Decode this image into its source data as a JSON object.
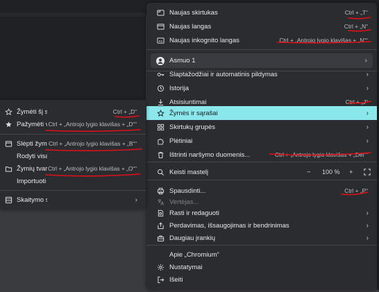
{
  "main_menu": {
    "new_tab": {
      "label": "Naujas skirtukas",
      "shortcut": "Ctrl + „T“"
    },
    "new_window": {
      "label": "Naujas langas",
      "shortcut": "Ctrl + „N“"
    },
    "incognito": {
      "label": "Naujas inkognito langas",
      "shortcut": "Ctrl + „Antrojo lygio klavišas + „N““"
    },
    "profile": {
      "label": "Asmuo 1"
    },
    "passwords": {
      "label": "Slaptažodžiai ir automatinis pildymas"
    },
    "history": {
      "label": "Istorija"
    },
    "downloads": {
      "label": "Atsisiuntimai",
      "shortcut": "Ctrl + „J“"
    },
    "bookmarks": {
      "label": "Žymės ir sąrašai"
    },
    "tab_groups": {
      "label": "Skirtukų grupės"
    },
    "extensions": {
      "label": "Plėtiniai"
    },
    "clear_data": {
      "label": "Ištrinti naršymo duomenis...",
      "shortcut": "Ctrl + „Antrojo lygio klavišas + „Del““"
    },
    "zoom": {
      "label": "Keisti mastelį",
      "minus": "−",
      "value": "100 %",
      "plus": "+"
    },
    "print": {
      "label": "Spausdinti...",
      "shortcut": "Ctrl + „P“"
    },
    "cast": {
      "label": "Vertėjas..."
    },
    "find_edit": {
      "label": "Rasti ir redaguoti"
    },
    "cast_save_share": {
      "label": "Perdavimas, išsaugojimas ir bendrinimas"
    },
    "more_tools": {
      "label": "Daugiau įrankių"
    },
    "about": {
      "label": "Apie „Chromium“"
    },
    "settings": {
      "label": "Nustatymai"
    },
    "exit": {
      "label": "Išeiti"
    }
  },
  "sub_menu": {
    "bookmark_tab": {
      "label": "Žymėti šį skirtuką",
      "shortcut": "Ctrl + „D“"
    },
    "bookmark_all": {
      "label": "Pažymėti visus skirtukus",
      "shortcut": "Ctrl + „Antrojo lygio klavišas + „D““"
    },
    "hide_bar": {
      "label": "Slėpti žymių juostą",
      "shortcut": "Ctrl + „Antrojo lygio klavišas + „B““"
    },
    "show_all": {
      "label": "Rodyti visas žymes"
    },
    "manager": {
      "label": "Žymių tvarkytuvė",
      "shortcut": "Ctrl + „Antrojo lygio klavišas + „O““"
    },
    "import": {
      "label": "Importuoti žymes ir nustatymus"
    },
    "reading_list": {
      "label": "Skaitymo sąrašas"
    }
  },
  "colors": {
    "highlight": "#8ae8ec",
    "menu_bg": "#2b2c30",
    "annotation": "#e0101a"
  }
}
